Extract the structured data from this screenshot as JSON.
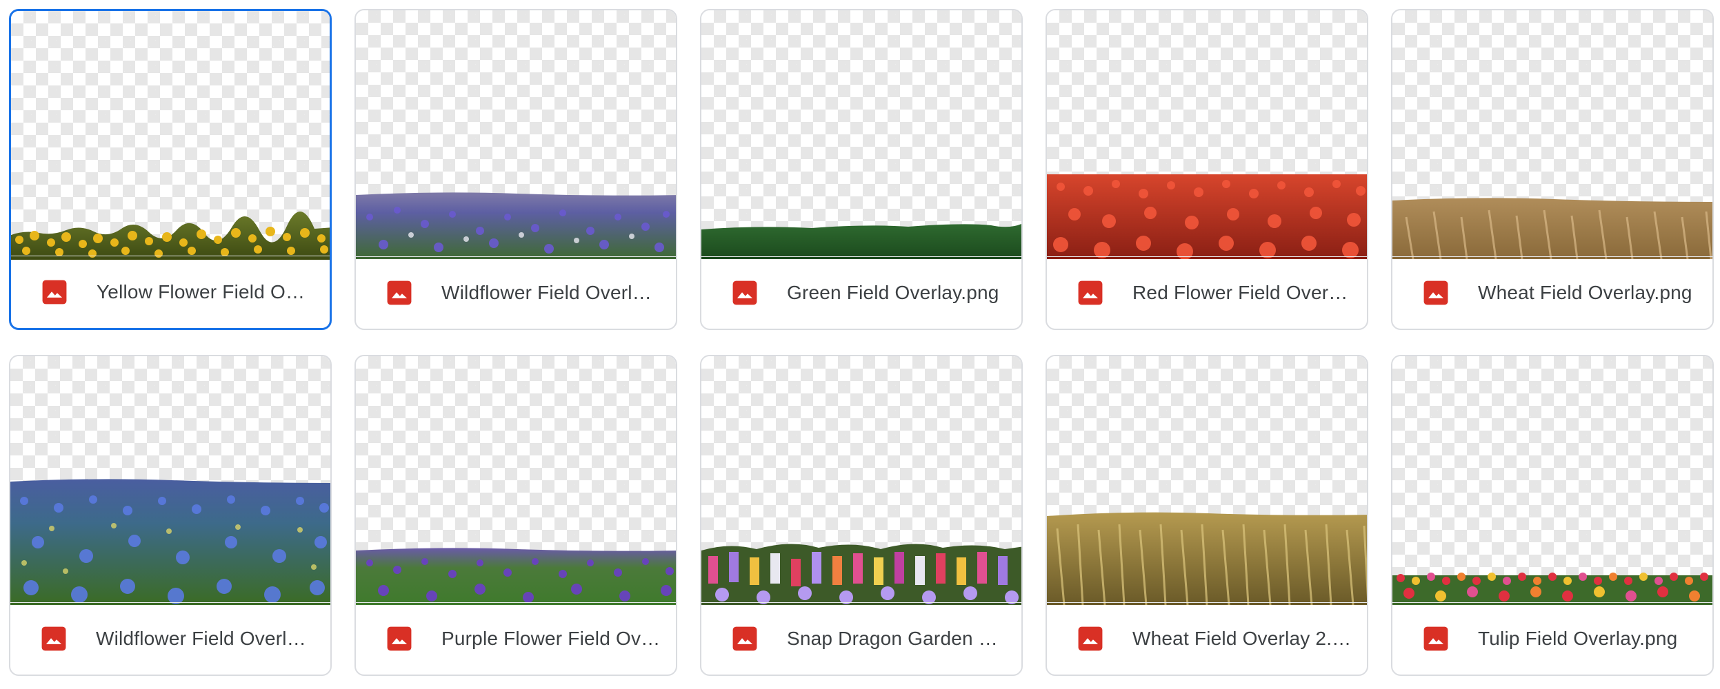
{
  "files": [
    {
      "name": "Yellow Flower Field Ov…",
      "icon": "image-file-icon",
      "selected": true,
      "theme": "yellow-flowers"
    },
    {
      "name": "Wildflower Field Overla…",
      "icon": "image-file-icon",
      "selected": false,
      "theme": "purple-wildflowers"
    },
    {
      "name": "Green Field Overlay.png",
      "icon": "image-file-icon",
      "selected": false,
      "theme": "green-grass"
    },
    {
      "name": "Red Flower Field Overl…",
      "icon": "image-file-icon",
      "selected": false,
      "theme": "red-poppies"
    },
    {
      "name": "Wheat Field Overlay.png",
      "icon": "image-file-icon",
      "selected": false,
      "theme": "wheat"
    },
    {
      "name": "Wildflower Field Overla…",
      "icon": "image-file-icon",
      "selected": false,
      "theme": "blue-wildflowers"
    },
    {
      "name": "Purple Flower Field Ov…",
      "icon": "image-file-icon",
      "selected": false,
      "theme": "purple-flowers"
    },
    {
      "name": "Snap Dragon Garden O…",
      "icon": "image-file-icon",
      "selected": false,
      "theme": "snapdragons"
    },
    {
      "name": "Wheat Field Overlay 2.…",
      "icon": "image-file-icon",
      "selected": false,
      "theme": "wheat-tall"
    },
    {
      "name": "Tulip Field Overlay.png",
      "icon": "image-file-icon",
      "selected": false,
      "theme": "tulips"
    }
  ],
  "colors": {
    "selection_border": "#1a73e8",
    "image_icon": "#d93025",
    "text": "#3c4043"
  }
}
